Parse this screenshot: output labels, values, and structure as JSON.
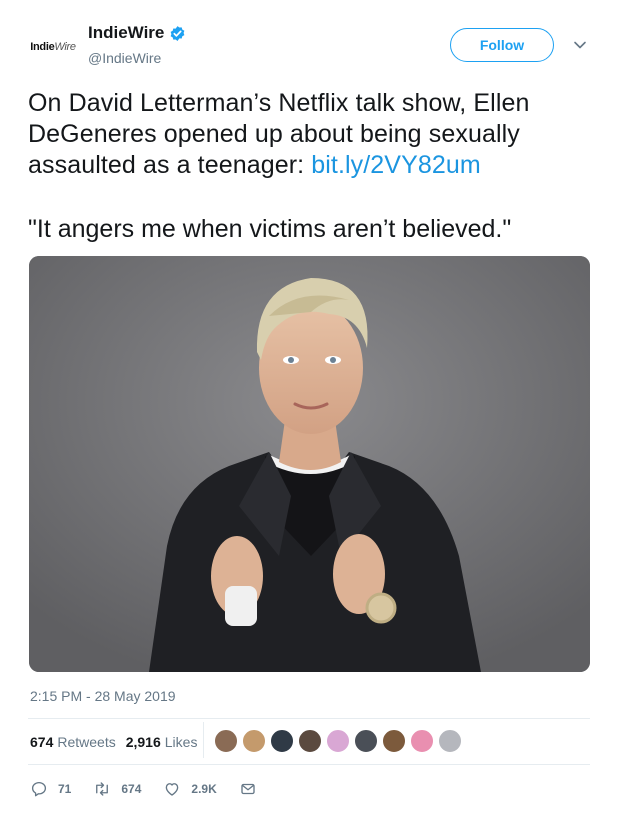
{
  "author": {
    "avatar_logo_main": "Indie",
    "avatar_logo_sub": "Wire",
    "display_name": "IndieWire",
    "handle": "@IndieWire"
  },
  "follow_label": "Follow",
  "tweet": {
    "text": "On David Letterman’s Netflix talk show, Ellen DeGeneres opened up about being sexually assaulted as a teenager: ",
    "link": "bit.ly/2VY82um",
    "quote": "\"It angers me when victims aren’t believed.\""
  },
  "timestamp": "2:15 PM - 28 May 2019",
  "stats": {
    "retweets_count": "674",
    "retweets_label": "Retweets",
    "likes_count": "2,916",
    "likes_label": "Likes"
  },
  "likers": [
    {
      "name": "liker-1",
      "color": "#8a6b55"
    },
    {
      "name": "liker-2",
      "color": "#c49a6c"
    },
    {
      "name": "liker-3",
      "color": "#2f3a46"
    },
    {
      "name": "liker-4",
      "color": "#5b4a3f"
    },
    {
      "name": "liker-5",
      "color": "#d9a7d4"
    },
    {
      "name": "liker-6",
      "color": "#4a4f57"
    },
    {
      "name": "liker-7",
      "color": "#7c5a3c"
    },
    {
      "name": "liker-8",
      "color": "#e98fb0"
    },
    {
      "name": "liker-9",
      "color": "#b5b7bd"
    }
  ],
  "actions": {
    "reply_count": "71",
    "retweet_count": "674",
    "like_count": "2.9K"
  },
  "icons": {
    "verified": "verified-badge-icon",
    "caret": "chevron-down-icon",
    "reply": "reply-icon",
    "retweet": "retweet-icon",
    "like": "heart-icon",
    "dm": "envelope-icon"
  },
  "colors": {
    "accent": "#1da1f2",
    "link": "#1b95e0",
    "muted": "#657786"
  }
}
